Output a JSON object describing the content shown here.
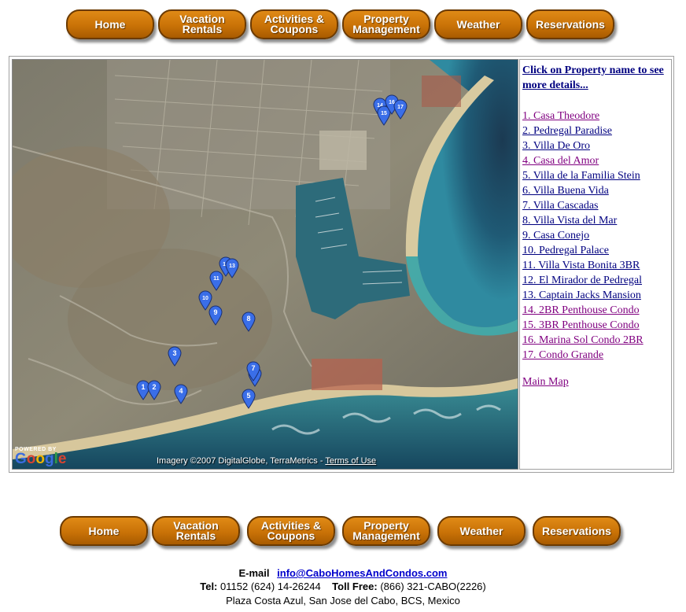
{
  "nav": {
    "items": [
      {
        "label": "Home"
      },
      {
        "label": "Vacation\nRentals"
      },
      {
        "label": "Activities &\nCoupons"
      },
      {
        "label": "Property\nManagement"
      },
      {
        "label": "Weather"
      },
      {
        "label": "Reservations"
      }
    ]
  },
  "sidebar": {
    "heading": "Click on Property name to see more details...",
    "properties": [
      {
        "label": "1. Casa Theodore",
        "visited": true
      },
      {
        "label": "2. Pedregal Paradise",
        "visited": false
      },
      {
        "label": "3. Villa De Oro",
        "visited": false
      },
      {
        "label": "4. Casa del Amor",
        "visited": true
      },
      {
        "label": "5. Villa de la Familia Stein",
        "visited": false
      },
      {
        "label": "6. Villa Buena Vida",
        "visited": false
      },
      {
        "label": "7. Villa Cascadas",
        "visited": false
      },
      {
        "label": "8. Villa Vista del Mar",
        "visited": false
      },
      {
        "label": "9. Casa Conejo",
        "visited": false
      },
      {
        "label": "10. Pedregal Palace",
        "visited": false
      },
      {
        "label": "11. Villa Vista Bonita 3BR",
        "visited": false
      },
      {
        "label": "12. El Mirador de Pedregal",
        "visited": false
      },
      {
        "label": "13. Captain Jacks Mansion",
        "visited": false
      },
      {
        "label": "14. 2BR Penthouse Condo",
        "visited": true
      },
      {
        "label": "15. 3BR Penthouse Condo",
        "visited": true
      },
      {
        "label": "16. Marina Sol Condo 2BR",
        "visited": true
      },
      {
        "label": "17. Condo Grande",
        "visited": true
      }
    ],
    "main_map": "Main Map"
  },
  "map": {
    "powered_by": "POWERED BY",
    "logo": "Google",
    "imagery_credit": "Imagery ©2007 DigitalGlobe, TerraMetrics -",
    "terms": "Terms of Use",
    "markers": [
      "1",
      "2",
      "3",
      "4",
      "5",
      "6",
      "7",
      "8",
      "9",
      "10",
      "11",
      "12",
      "13",
      "14",
      "15",
      "16",
      "17"
    ]
  },
  "footer": {
    "email_label": "E-mail",
    "email": "info@CaboHomesAndCondos.com",
    "tel_label": "Tel:",
    "tel": "01152 (624) 14-26244",
    "tollfree_label": "Toll Free:",
    "tollfree": "(866) 321-CABO(2226)",
    "address": "Plaza Costa Azul, San Jose del Cabo, BCS, Mexico"
  },
  "colors": {
    "button": "#c97207",
    "link": "#000080",
    "visited": "#800080",
    "marker": "#3a6ee8"
  }
}
